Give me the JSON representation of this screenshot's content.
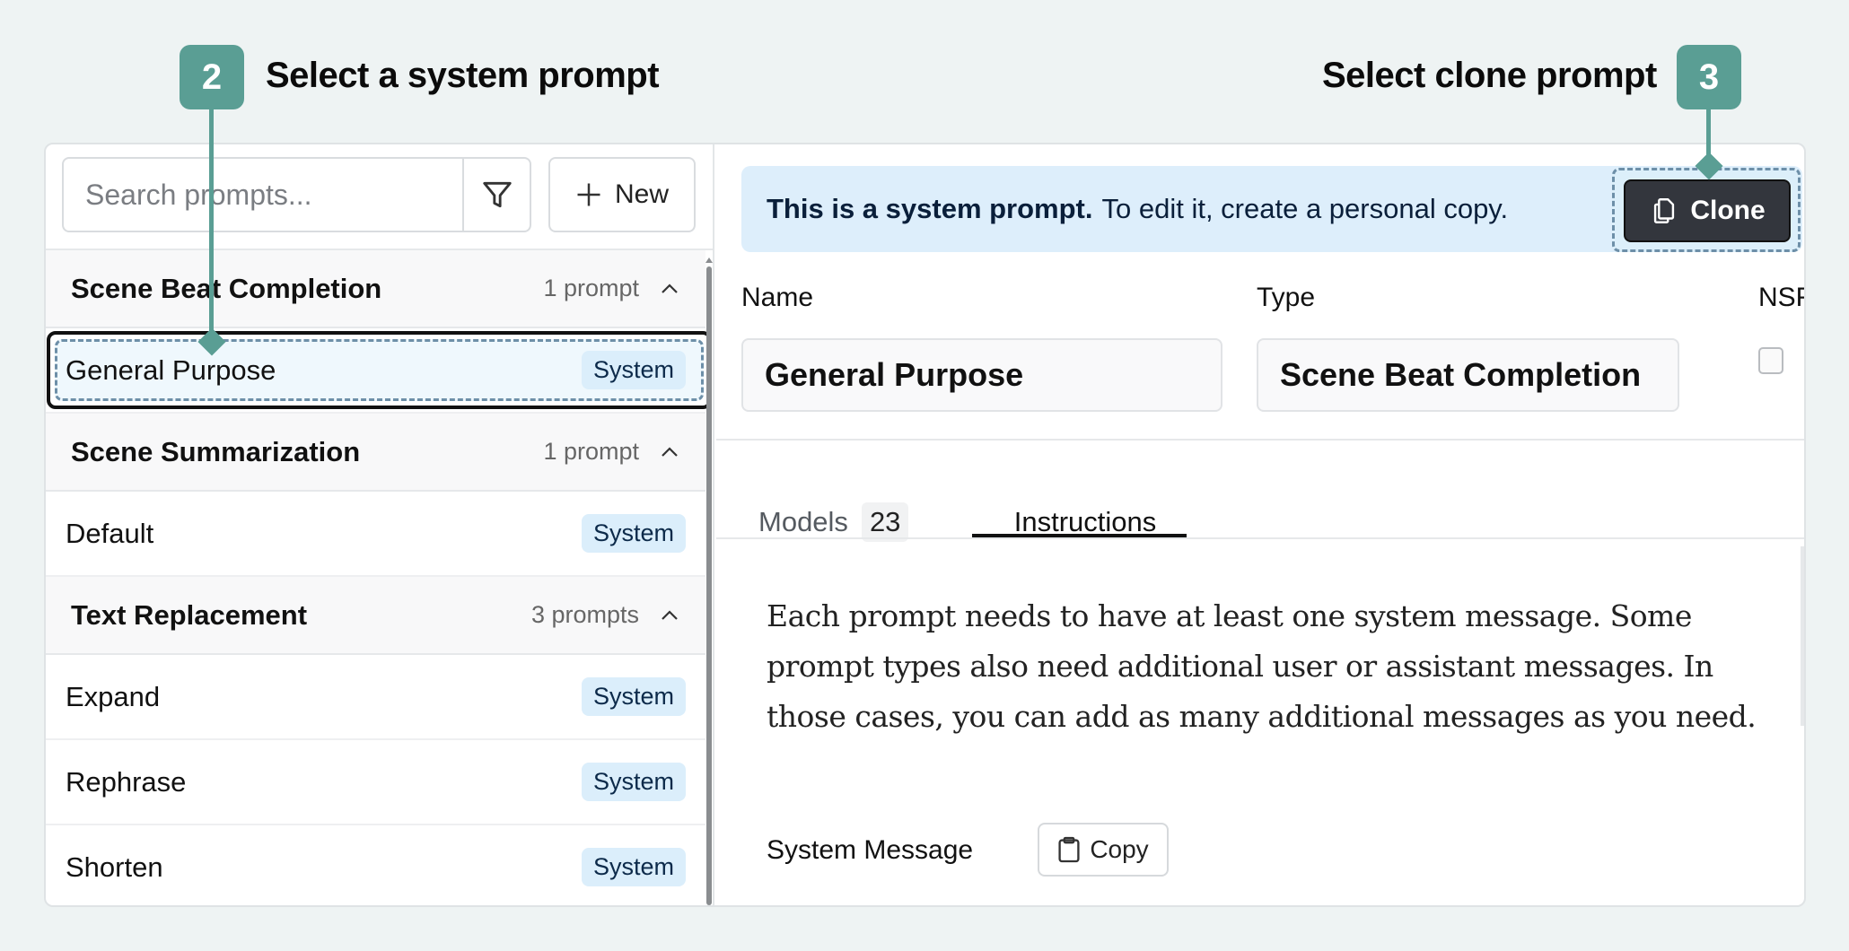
{
  "annotations": {
    "step2": {
      "number": "2",
      "label": "Select a system prompt"
    },
    "step3": {
      "number": "3",
      "label": "Select clone prompt"
    },
    "accent_color": "#5a9e94"
  },
  "sidebar": {
    "search": {
      "placeholder": "Search prompts...",
      "value": ""
    },
    "filter_icon": "filter-icon",
    "new_button": {
      "label": "New",
      "icon": "plus-icon"
    },
    "groups": [
      {
        "title": "Scene Beat Completion",
        "count": "1 prompt",
        "expanded": true,
        "items": [
          {
            "name": "General Purpose",
            "badge": "System",
            "selected": true
          }
        ]
      },
      {
        "title": "Scene Summarization",
        "count": "1 prompt",
        "expanded": true,
        "items": [
          {
            "name": "Default",
            "badge": "System",
            "selected": false
          }
        ]
      },
      {
        "title": "Text Replacement",
        "count": "3 prompts",
        "expanded": true,
        "items": [
          {
            "name": "Expand",
            "badge": "System",
            "selected": false
          },
          {
            "name": "Rephrase",
            "badge": "System",
            "selected": false
          },
          {
            "name": "Shorten",
            "badge": "System",
            "selected": false
          }
        ]
      }
    ]
  },
  "detail": {
    "banner": {
      "bold": "This is a system prompt.",
      "text": "To edit it, create a personal copy.",
      "clone_label": "Clone"
    },
    "fields": {
      "name_label": "Name",
      "name_value": "General Purpose",
      "type_label": "Type",
      "type_value": "Scene Beat Completion",
      "nsfw_label": "NSFW",
      "nsfw_checked": false
    },
    "tabs": [
      {
        "label": "Models",
        "count": "23",
        "active": false
      },
      {
        "label": "Instructions",
        "active": true
      }
    ],
    "instructions_text": "Each prompt needs to have at least one system message. Some prompt types also need additional user or assistant messages. In those cases, you can add as many additional messages as you need.",
    "system_message_label": "System Message",
    "copy_label": "Copy"
  }
}
